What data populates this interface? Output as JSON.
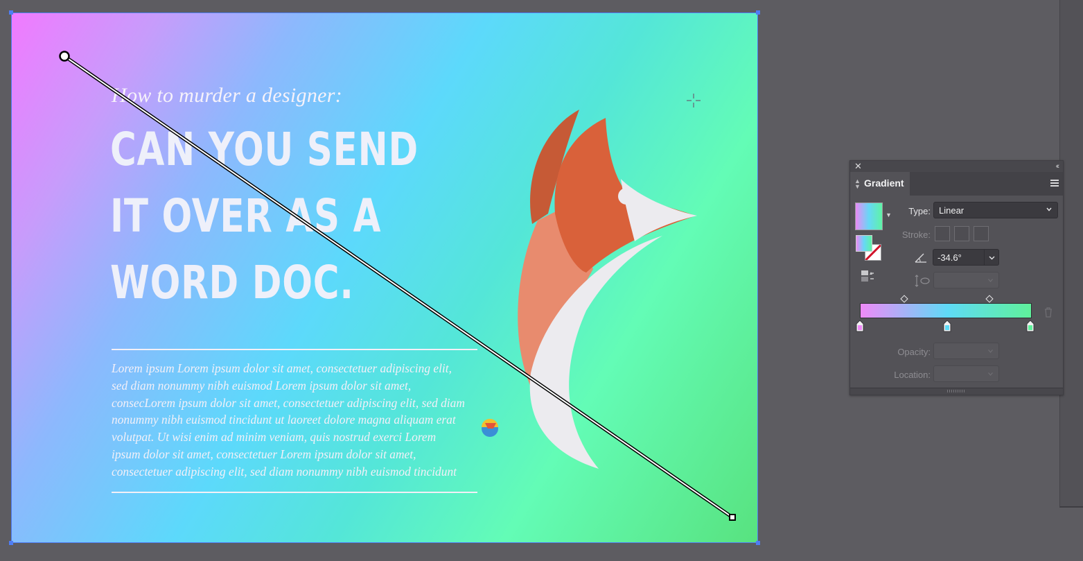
{
  "artboard": {
    "kicker": "How to murder a designer:",
    "headline": [
      "CAN YOU SEND",
      "IT OVER AS A",
      "WORD DOC."
    ],
    "body_lines": [
      "Lorem ipsum Lorem ipsum dolor sit amet, consectetuer adipiscing elit,",
      "sed diam nonummy nibh euismod Lorem ipsum dolor sit amet,",
      "consecLorem ipsum dolor sit amet, consectetuer adipiscing elit, sed diam",
      "nonummy nibh euismod tincidunt ut laoreet dolore magna aliquam erat",
      "volutpat. Ut wisi enim ad minim veniam, quis nostrud exerci Lorem",
      "ipsum dolor sit amet, consectetuer Lorem ipsum dolor sit amet,",
      "consectetuer adipiscing elit, sed diam nonummy nibh euismod tincidunt"
    ],
    "background_colors": [
      "#f17aff",
      "#8db8fd",
      "#5cd9fb",
      "#63fcb6",
      "#58e27f"
    ],
    "fox_colors": {
      "ear_dark": "#c65a36",
      "head": "#d9613a",
      "cheek_light": "#e88b6e",
      "white": "#ecebef"
    }
  },
  "gradient_panel": {
    "title": "Gradient",
    "type_label": "Type:",
    "type_value": "Linear",
    "stroke_label": "Stroke:",
    "angle_value": "-34.6°",
    "opacity_label": "Opacity:",
    "location_label": "Location:",
    "gradient_stops": [
      {
        "color": "#ef8af7",
        "location": 0
      },
      {
        "color": "#5fdaf6",
        "location": 51
      },
      {
        "color": "#5ff19b",
        "location": 100
      }
    ],
    "icons": [
      "close-icon",
      "collapse-icon",
      "panel-menu-icon",
      "reverse-gradient-icon",
      "angle-icon",
      "aspect-ratio-icon",
      "trash-icon"
    ]
  }
}
